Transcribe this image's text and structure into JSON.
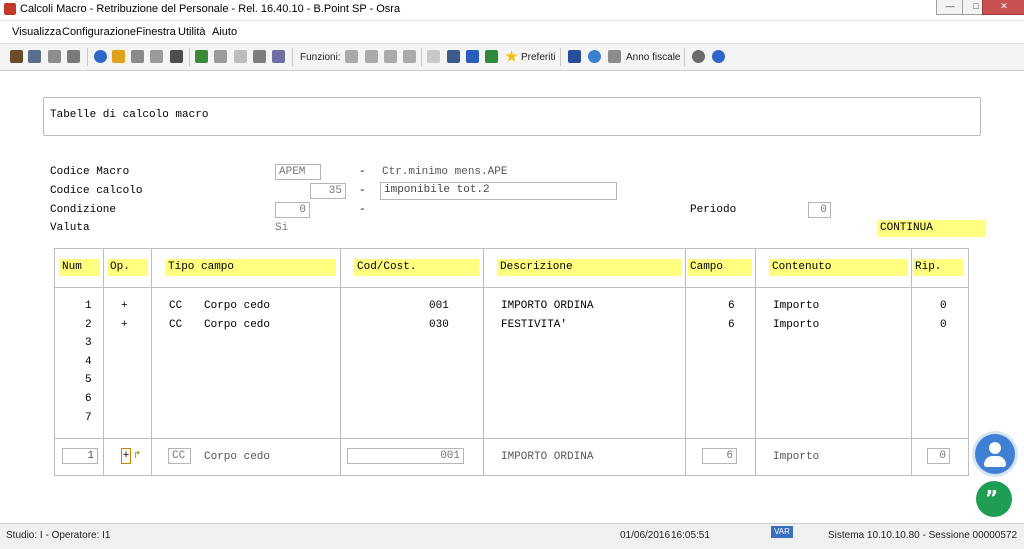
{
  "window": {
    "title": "Calcoli Macro - Retribuzione del Personale - Rel. 16.40.10 - B.Point SP - Osra"
  },
  "menu": [
    "Visualizza",
    "Configurazione",
    "Finestra",
    "Utilità",
    "Aiuto"
  ],
  "toolbar": {
    "funzioni_label": "Funzioni:",
    "preferiti_label": "Preferiti",
    "anno_fiscale_label": "Anno fiscale"
  },
  "panel": {
    "title": "Tabelle di calcolo macro"
  },
  "form": {
    "codice_macro_label": "Codice Macro",
    "codice_macro_value": "APEM",
    "codice_macro_desc": "Ctr.minimo mens.APE",
    "codice_calcolo_label": "Codice calcolo",
    "codice_calcolo_value": "35",
    "codice_calcolo_desc": "imponibile tot.2",
    "condizione_label": "Condizione",
    "condizione_value": "0",
    "valuta_label": "Valuta",
    "valuta_value": "Si",
    "periodo_label": "Periodo",
    "periodo_value": "0",
    "dash": "-",
    "continua": "CONTINUA"
  },
  "table": {
    "headers": [
      "Num",
      "Op.",
      "Tipo campo",
      "Cod/Cost.",
      "Descrizione",
      "Campo",
      "Contenuto",
      "Rip."
    ],
    "rows": [
      {
        "num": "1",
        "op": "+",
        "tipo": "CC",
        "tipo_desc": "Corpo cedo",
        "cod": "001",
        "descr": "IMPORTO ORDINA",
        "campo": "6",
        "contenuto": "Importo",
        "rip": "0"
      },
      {
        "num": "2",
        "op": "+",
        "tipo": "CC",
        "tipo_desc": "Corpo cedo",
        "cod": "030",
        "descr": "FESTIVITA'",
        "campo": "6",
        "contenuto": "Importo",
        "rip": "0"
      },
      {
        "num": "3"
      },
      {
        "num": "4"
      },
      {
        "num": "5"
      },
      {
        "num": "6"
      },
      {
        "num": "7"
      }
    ],
    "edit": {
      "num": "1",
      "op": "+",
      "tipo": "CC",
      "tipo_desc": "Corpo cedo",
      "cod": "001",
      "descr": "IMPORTO ORDINA",
      "campo": "6",
      "contenuto": "Importo",
      "rip": "0"
    }
  },
  "status": {
    "studio": "Studio: I - Operatore: I1",
    "date": "01/06/2016",
    "time": "16:05:51",
    "var": "VAR",
    "sistema": "Sistema 10.10.10.80 - Sessione 00000572"
  },
  "colors": {
    "highlight": "#ffff80",
    "fab_blue": "#3f7fd4",
    "fab_green": "#1f9d55"
  }
}
